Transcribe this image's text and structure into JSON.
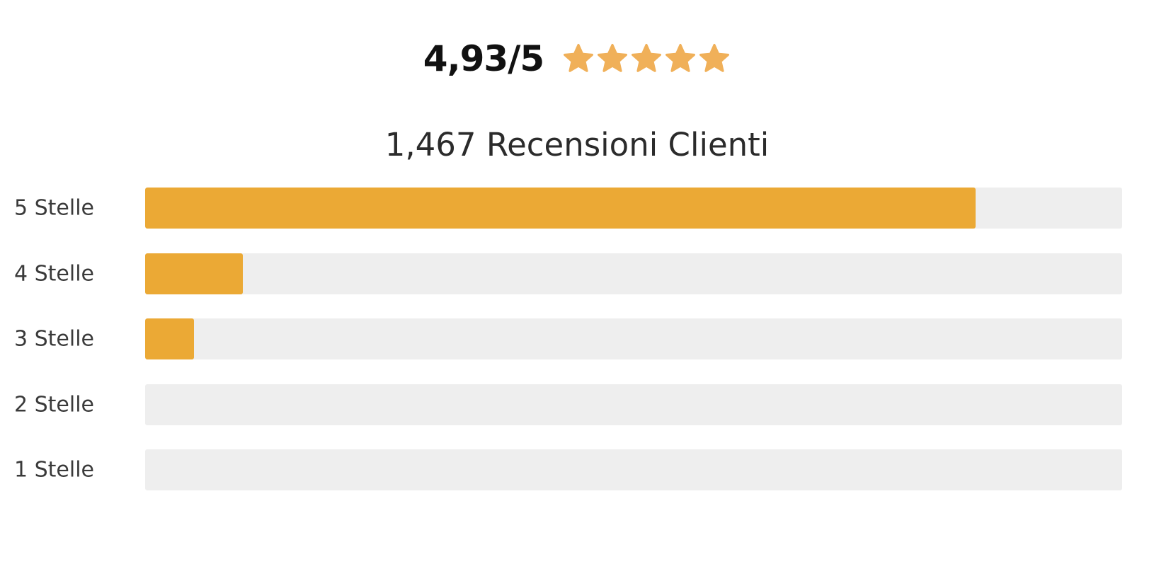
{
  "summary": {
    "score": "4,93/5",
    "star_count": 5,
    "star_icon": "star-icon",
    "review_count_label": "1,467 Recensioni Clienti"
  },
  "colors": {
    "star": "#f0b059",
    "bar_fill": "#eba935",
    "bar_track": "#eeeeee"
  },
  "rating_rows": [
    {
      "label": "5 Stelle",
      "fill_fraction": 0.85
    },
    {
      "label": "4 Stelle",
      "fill_fraction": 0.1
    },
    {
      "label": "3 Stelle",
      "fill_fraction": 0.05
    },
    {
      "label": "2 Stelle",
      "fill_fraction": 0.0
    },
    {
      "label": "1 Stelle",
      "fill_fraction": 0.0
    }
  ]
}
